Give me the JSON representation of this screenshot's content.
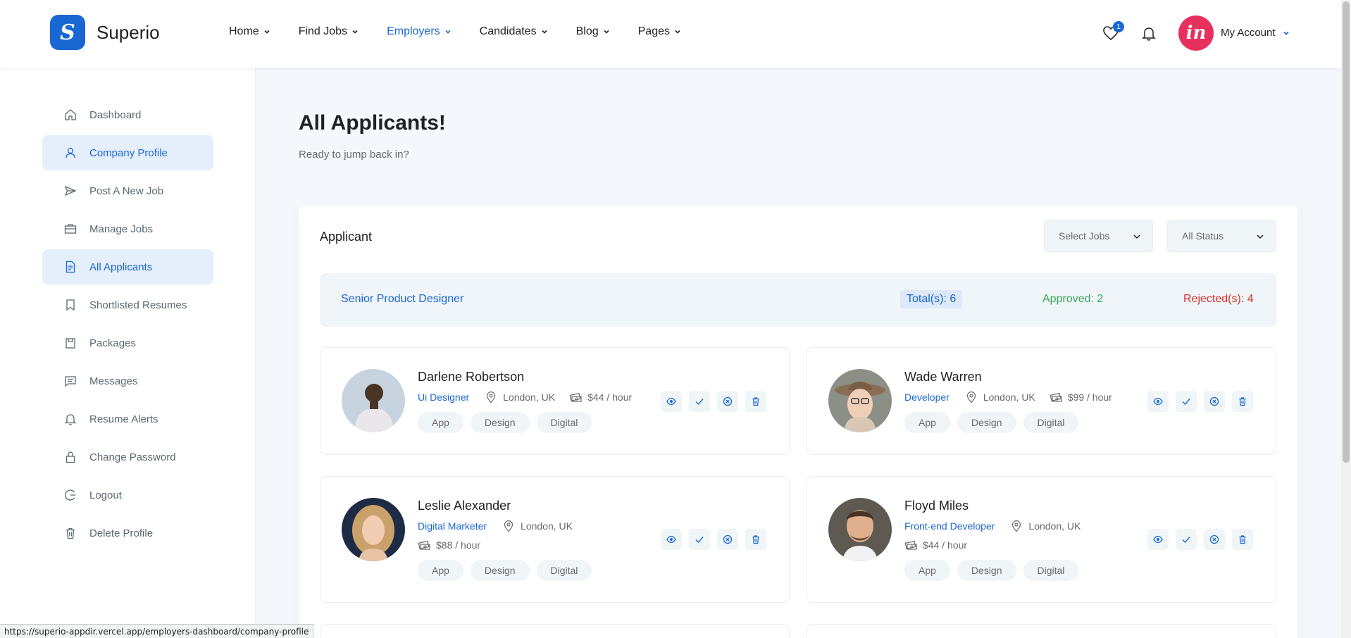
{
  "brand": {
    "name": "Superio",
    "logo_icon": "superio-logo-icon"
  },
  "nav": [
    {
      "label": "Home",
      "active": false
    },
    {
      "label": "Find Jobs",
      "active": false
    },
    {
      "label": "Employers",
      "active": true
    },
    {
      "label": "Candidates",
      "active": false
    },
    {
      "label": "Blog",
      "active": false
    },
    {
      "label": "Pages",
      "active": false
    }
  ],
  "header": {
    "wishlist_count": "1",
    "account_label": "My Account",
    "account_avatar_letter": "in"
  },
  "sidebar": [
    {
      "label": "Dashboard",
      "icon": "home-icon",
      "active": false
    },
    {
      "label": "Company Profile",
      "icon": "user-icon",
      "active": true
    },
    {
      "label": "Post A New Job",
      "icon": "paper-plane-icon",
      "active": false
    },
    {
      "label": "Manage Jobs",
      "icon": "briefcase-icon",
      "active": false
    },
    {
      "label": "All Applicants",
      "icon": "document-icon",
      "active": true
    },
    {
      "label": "Shortlisted Resumes",
      "icon": "bookmark-icon",
      "active": false
    },
    {
      "label": "Packages",
      "icon": "package-icon",
      "active": false
    },
    {
      "label": "Messages",
      "icon": "message-icon",
      "active": false
    },
    {
      "label": "Resume Alerts",
      "icon": "bell-icon",
      "active": false
    },
    {
      "label": "Change Password",
      "icon": "lock-icon",
      "active": false
    },
    {
      "label": "Logout",
      "icon": "logout-icon",
      "active": false
    },
    {
      "label": "Delete Profile",
      "icon": "trash-icon",
      "active": false
    }
  ],
  "page": {
    "title": "All Applicants!",
    "subtitle": "Ready to jump back in?"
  },
  "panel": {
    "title": "Applicant",
    "select_jobs": "Select Jobs",
    "select_status": "All Status",
    "job": {
      "name": "Senior Product Designer",
      "total": "Total(s): 6",
      "approved": "Approved: 2",
      "rejected": "Rejected(s): 4"
    }
  },
  "applicants": [
    {
      "name": "Darlene Robertson",
      "role": "Ui Designer",
      "location": "London, UK",
      "rate": "$44 / hour",
      "tags": [
        "App",
        "Design",
        "Digital"
      ]
    },
    {
      "name": "Wade Warren",
      "role": "Developer",
      "location": "London, UK",
      "rate": "$99 / hour",
      "tags": [
        "App",
        "Design",
        "Digital"
      ]
    },
    {
      "name": "Leslie Alexander",
      "role": "Digital Marketer",
      "location": "London, UK",
      "rate": "$88 / hour",
      "tags": [
        "App",
        "Design",
        "Digital"
      ]
    },
    {
      "name": "Floyd Miles",
      "role": "Front-end Developer",
      "location": "London, UK",
      "rate": "$44 / hour",
      "tags": [
        "App",
        "Design",
        "Digital"
      ]
    }
  ],
  "status_bar_url": "https://superio-appdir.vercel.app/employers-dashboard/company-profile",
  "colors": {
    "primary": "#1967d2",
    "approved": "#34a853",
    "rejected": "#d93025",
    "avatar_brand": "#e8305f"
  }
}
